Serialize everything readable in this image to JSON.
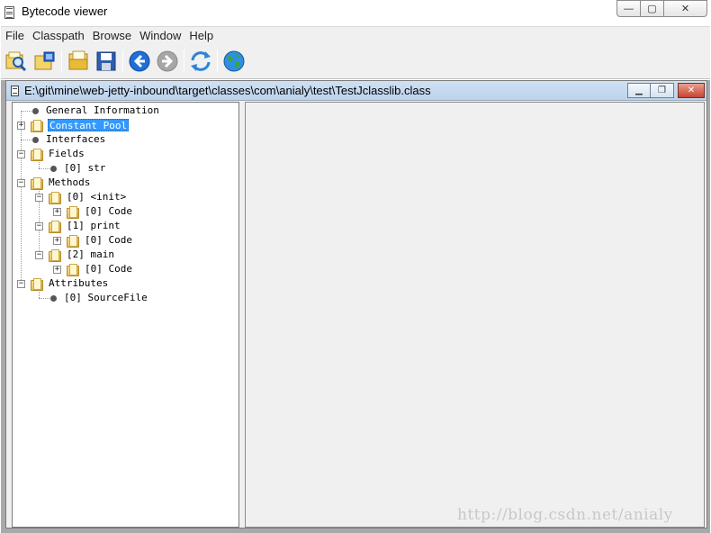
{
  "window": {
    "title": "Bytecode viewer",
    "controls": {
      "minimize": "—",
      "maximize": "▢",
      "close": "✕"
    }
  },
  "menu": [
    "File",
    "Classpath",
    "Browse",
    "Window",
    "Help"
  ],
  "toolbar": [
    {
      "name": "open-class-icon"
    },
    {
      "name": "open-classpath-icon"
    },
    {
      "name": "open-folder-icon"
    },
    {
      "name": "save-icon"
    },
    {
      "name": "back-icon"
    },
    {
      "name": "forward-icon"
    },
    {
      "name": "reload-icon"
    },
    {
      "name": "web-icon"
    }
  ],
  "inner_window": {
    "path": "E:\\git\\mine\\web-jetty-inbound\\target\\classes\\com\\anialy\\test\\TestJclasslib.class",
    "controls": {
      "minimize": "▁",
      "restore": "❐",
      "close": "✕"
    }
  },
  "tree": [
    {
      "label": "General Information"
    },
    {
      "label": "Constant Pool",
      "expander": "+"
    },
    {
      "label": "Interfaces"
    },
    {
      "label": "Fields",
      "expander": "−"
    },
    {
      "label": "[0] str"
    },
    {
      "label": "Methods",
      "expander": "−"
    },
    {
      "label": "[0] <init>",
      "expander": "−"
    },
    {
      "label": "[0] Code",
      "expander": "+"
    },
    {
      "label": "[1] print",
      "expander": "−"
    },
    {
      "label": "[0] Code",
      "expander": "+"
    },
    {
      "label": "[2] main",
      "expander": "−"
    },
    {
      "label": "[0] Code",
      "expander": "+"
    },
    {
      "label": "Attributes",
      "expander": "−"
    },
    {
      "label": "[0] SourceFile"
    }
  ],
  "selected_item": "Constant Pool",
  "watermark": "http://blog.csdn.net/anialy",
  "colors": {
    "selection": "#3399ff",
    "inner_title": "#c4d8ef"
  }
}
